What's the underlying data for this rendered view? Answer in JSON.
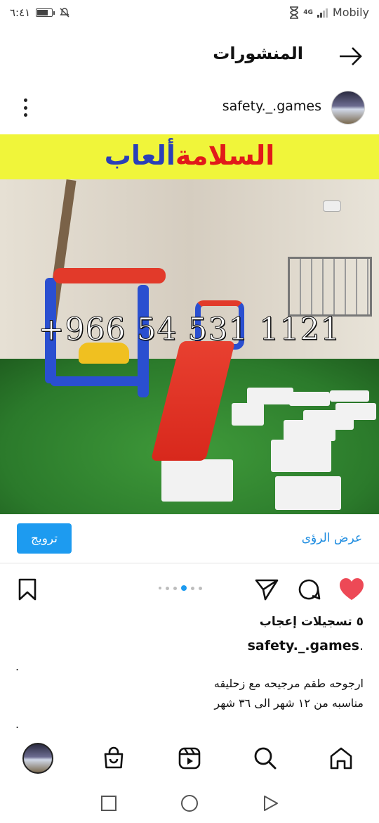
{
  "status_bar": {
    "time": "٦:٤١",
    "carrier": "Mobily",
    "network": "4G",
    "battery_level": 0.8
  },
  "header": {
    "title": "المنشورات",
    "back_icon": "arrow-right-icon"
  },
  "post": {
    "author": "safety._.games",
    "banner": {
      "red_part": "السلامة",
      "blue_part": "ألعاب"
    },
    "watermark": "+966 54 531 1121",
    "carousel": {
      "count": 5,
      "active_index": 3
    },
    "promote_label": "ترويج",
    "insights_label": "عرض الرؤى",
    "likes_text": "٥ تسجيلات إعجاب",
    "caption_user": "safety._.games",
    "caption_suffix": " .",
    "caption_dot_top": ".",
    "caption_lines": [
      "ارجوحه طقم مرجيحه مع زحليقه",
      "مناسبه من ١٢ شهر الى ٣٦ شهر"
    ],
    "caption_dot_bottom": "."
  },
  "colors": {
    "accent": "#1d9bf0",
    "like": "#ed4956",
    "banner_bg": "#f0f53a",
    "banner_red": "#e11a1a",
    "banner_blue": "#2a3fb8"
  },
  "bottom_nav": [
    "profile-avatar",
    "shop-icon",
    "reels-icon",
    "search-icon",
    "home-icon"
  ],
  "system_nav": [
    "recents-icon",
    "home-circle-icon",
    "back-triangle-icon"
  ]
}
